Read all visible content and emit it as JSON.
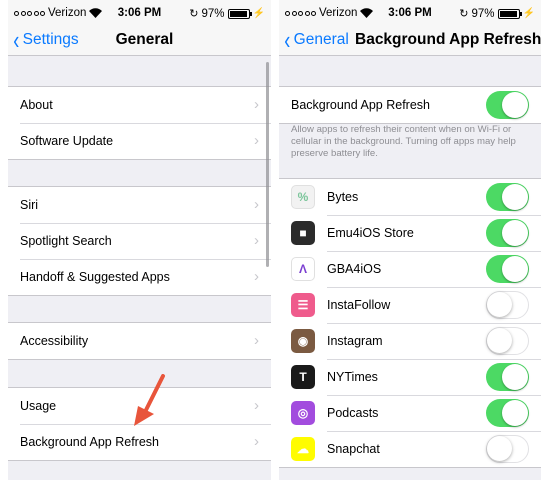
{
  "left": {
    "status": {
      "carrier": "Verizon",
      "time": "3:06 PM",
      "battery": "97%",
      "battery_level": 0.97
    },
    "nav": {
      "back_label": "Settings",
      "title": "General"
    },
    "group1": [
      "About",
      "Software Update"
    ],
    "group2": [
      "Siri",
      "Spotlight Search",
      "Handoff & Suggested Apps"
    ],
    "group3": [
      "Accessibility"
    ],
    "group4": [
      "Usage",
      "Background App Refresh"
    ]
  },
  "right": {
    "status": {
      "carrier": "Verizon",
      "time": "3:06 PM",
      "battery": "97%",
      "battery_level": 0.97
    },
    "nav": {
      "back_label": "General",
      "title": "Background App Refresh"
    },
    "master": {
      "label": "Background App Refresh",
      "on": true
    },
    "footer": "Allow apps to refresh their content when on Wi-Fi or cellular in the background. Turning off apps may help preserve battery life.",
    "apps": [
      {
        "name": "Bytes",
        "on": true,
        "icon": "bytes-icon",
        "color": "#f2f2f2"
      },
      {
        "name": "Emu4iOS Store",
        "on": true,
        "icon": "gamepad-icon",
        "color": "#2b2b2b"
      },
      {
        "name": "GBA4iOS",
        "on": true,
        "icon": "gba4ios-icon",
        "color": "#ffffff"
      },
      {
        "name": "InstaFollow",
        "on": false,
        "icon": "instafollow-icon",
        "color": "#ef5b8c"
      },
      {
        "name": "Instagram",
        "on": false,
        "icon": "instagram-icon",
        "color": "#7b5a41"
      },
      {
        "name": "NYTimes",
        "on": true,
        "icon": "nytimes-icon",
        "color": "#1a1a1a"
      },
      {
        "name": "Podcasts",
        "on": true,
        "icon": "podcasts-icon",
        "color": "#a24cde"
      },
      {
        "name": "Snapchat",
        "on": false,
        "icon": "snapchat-icon",
        "color": "#fffc00"
      }
    ]
  },
  "colors": {
    "accent": "#0a7aff",
    "toggle_on": "#4cd964",
    "arrow": "#e8553b"
  }
}
